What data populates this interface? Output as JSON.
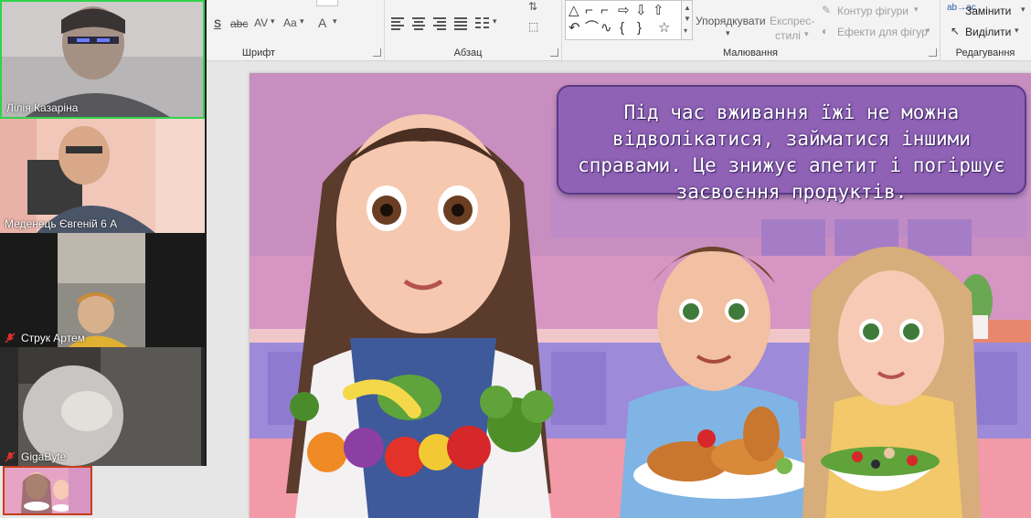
{
  "ribbon": {
    "groups": {
      "font": "Шрифт",
      "paragraph": "Абзац",
      "drawing": "Малювання",
      "editing": "Редагування"
    },
    "drawing": {
      "arrange": "Упорядкувати",
      "quick_styles_line1": "Експрес-",
      "quick_styles_line2": "стилі",
      "shape_outline": "Контур фігури",
      "shape_effects": "Ефекти для фігур"
    },
    "editing": {
      "replace": "Замінити",
      "select": "Виділити"
    },
    "font_buttons": {
      "shadow": "S",
      "strikethrough": "abc",
      "spacing": "AV",
      "change_case": "Aa",
      "font_color": "A"
    }
  },
  "participants": [
    {
      "name": "Лілія Казаріна",
      "muted": false,
      "active": true
    },
    {
      "name": "Меденець Євгеній 6 А",
      "muted": false,
      "active": false
    },
    {
      "name": "Струк Артем",
      "muted": true,
      "active": false
    },
    {
      "name": "GigaByte",
      "muted": true,
      "active": false
    }
  ],
  "slide": {
    "text": "Під час вживання їжі не можна відволікатися, займатися іншими справами. Це знижує апетит і погіршує засвоєння продуктів."
  },
  "colors": {
    "active_speaker": "#2fd34a",
    "speech_bubble": "#8c5fb4",
    "thumb_border": "#c43e1c",
    "muted_mic": "#e0302b"
  }
}
